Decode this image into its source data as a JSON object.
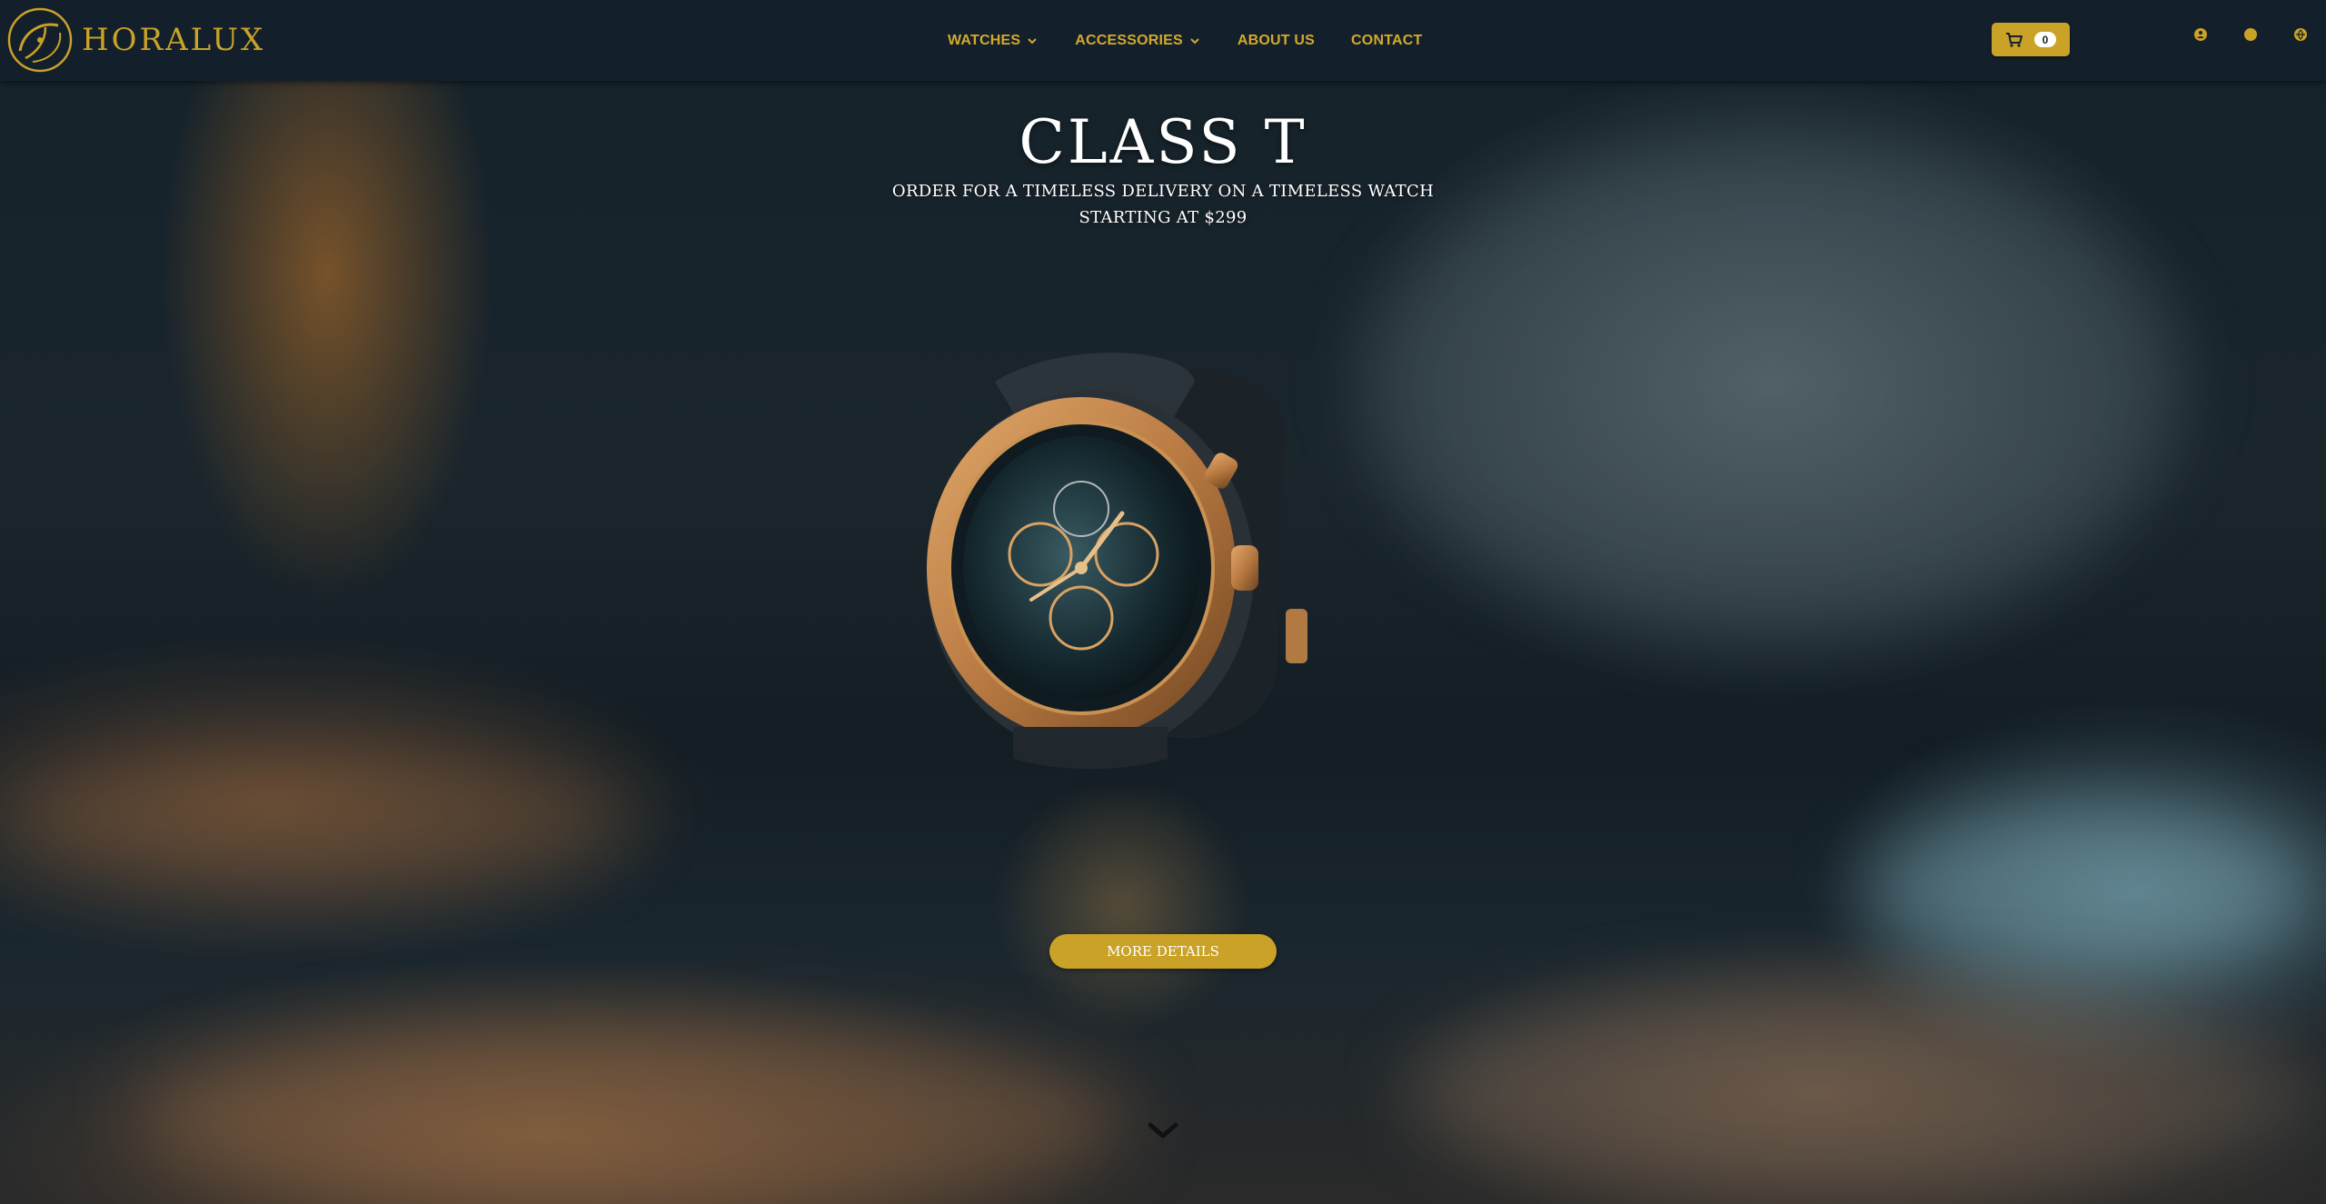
{
  "brand": {
    "name": "HORALUX",
    "logo_icon": "compass-swirl-logo-icon",
    "accent_color": "#c9a227"
  },
  "nav": {
    "items": [
      {
        "label": "WATCHES",
        "has_dropdown": true
      },
      {
        "label": "ACCESSORIES",
        "has_dropdown": true
      },
      {
        "label": "ABOUT US",
        "has_dropdown": false
      },
      {
        "label": "CONTACT",
        "has_dropdown": false
      }
    ]
  },
  "cart": {
    "icon": "cart-icon",
    "count": "0"
  },
  "utility_icons": [
    "user-icon",
    "circle-icon",
    "globe-icon"
  ],
  "hero": {
    "title": "CLASS T",
    "subtitle_line1": "ORDER FOR A TIMELESS DELIVERY ON A TIMELESS WATCH",
    "subtitle_line2": "STARTING AT $299",
    "cta_label": "MORE DETAILS",
    "scroll_icon": "chevron-down-icon"
  }
}
